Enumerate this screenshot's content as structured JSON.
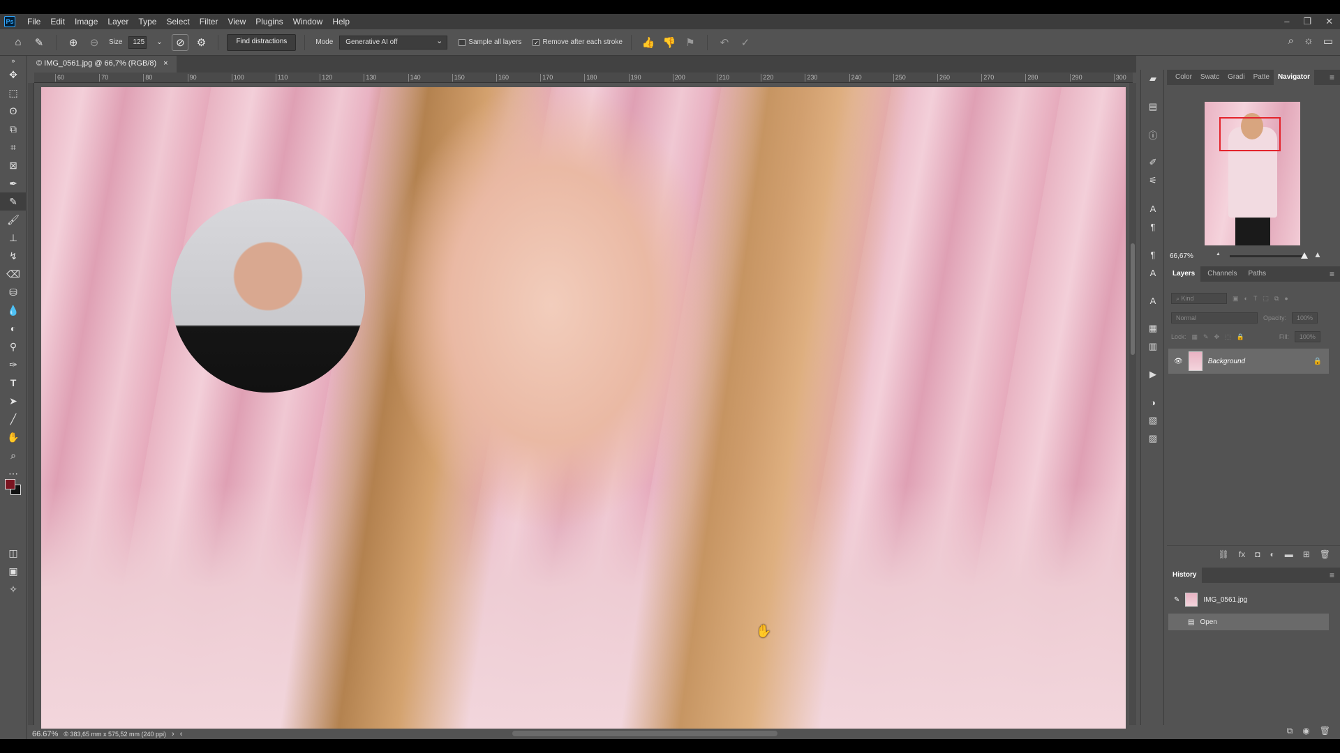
{
  "app": {
    "logo": "Ps"
  },
  "menu": [
    "File",
    "Edit",
    "Image",
    "Layer",
    "Type",
    "Select",
    "Filter",
    "View",
    "Plugins",
    "Window",
    "Help"
  ],
  "window_controls": {
    "minimize": "–",
    "restore": "❐",
    "close": "✕"
  },
  "options": {
    "size_label": "Size",
    "size_value": "125",
    "find_distractions_label": "Find distractions",
    "mode_label": "Mode",
    "mode_value": "Generative AI off",
    "sample_all_layers_label": "Sample all layers",
    "remove_after_stroke_label": "Remove after each stroke"
  },
  "document": {
    "tab_title": "© IMG_0561.jpg @ 66,7% (RGB/8)",
    "tab_close": "×"
  },
  "ruler_ticks": [
    "60",
    "70",
    "80",
    "90",
    "100",
    "110",
    "120",
    "130",
    "140",
    "150",
    "160",
    "170",
    "180",
    "190",
    "200",
    "210",
    "220",
    "230",
    "240",
    "250",
    "260",
    "270",
    "280",
    "290",
    "300"
  ],
  "status": {
    "zoom": "66.67%",
    "info": "© 383,65 mm x 575,52 mm (240 ppi)",
    "arrow": "›",
    "scroll_left": "‹"
  },
  "panel_tabs_top": [
    "Color",
    "Swatc",
    "Gradi",
    "Patte",
    "Navigator"
  ],
  "navigator": {
    "zoom": "66,67%",
    "zoom_out": "▲",
    "zoom_in": "▲"
  },
  "layers_tabs": [
    "Layers",
    "Channels",
    "Paths"
  ],
  "layers_filter": {
    "kind": "Kind",
    "blend": "Normal",
    "opacity_label": "Opacity:",
    "opacity_value": "100%",
    "lock_label": "Lock:",
    "fill_label": "Fill:",
    "fill_value": "100%"
  },
  "layers": [
    {
      "name": "Background"
    }
  ],
  "history_title": "History",
  "history": {
    "snapshot": "IMG_0561.jpg",
    "states": [
      "Open"
    ]
  },
  "colors": {
    "foreground": "#7a1420",
    "background": "#111111",
    "navigator_box": "#e4232b"
  }
}
